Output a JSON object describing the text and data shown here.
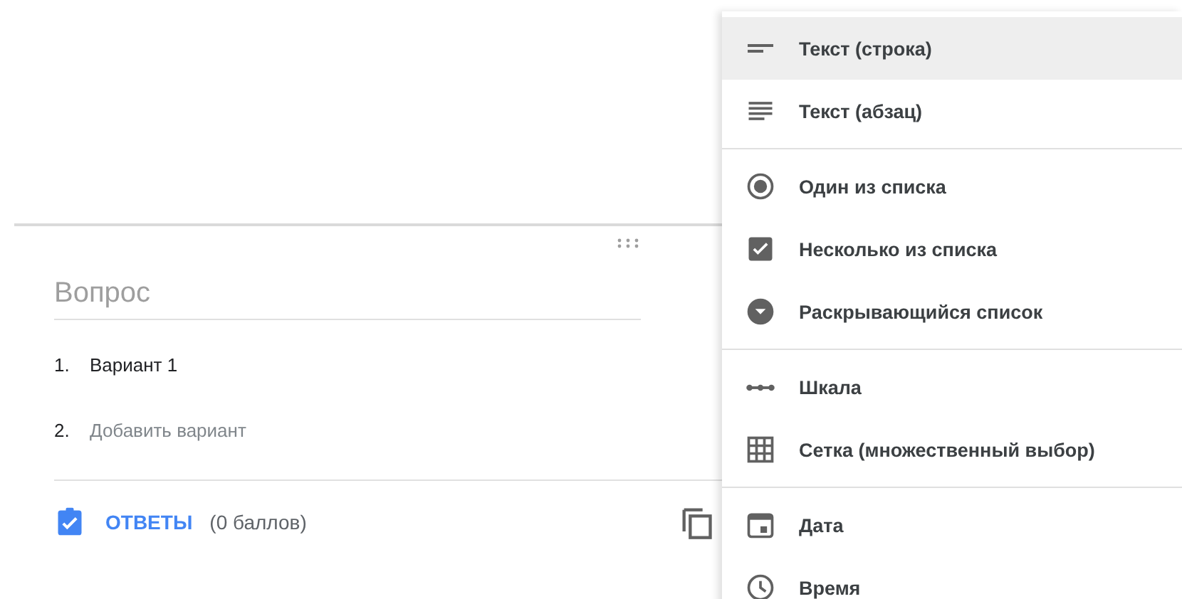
{
  "question_card": {
    "question": {
      "placeholder": "Вопрос"
    },
    "options": [
      {
        "number": "1.",
        "text": "Вариант 1",
        "kind": "option"
      },
      {
        "number": "2.",
        "text": "Добавить вариант",
        "kind": "add"
      }
    ],
    "answer_key": {
      "label": "ОТВЕТЫ",
      "points": "(0 баллов)"
    }
  },
  "type_menu": {
    "groups": [
      {
        "items": [
          {
            "label": "Текст (строка)",
            "kind": "short",
            "selected": true
          },
          {
            "label": "Текст (абзац)",
            "kind": "paragraph",
            "selected": false
          }
        ]
      },
      {
        "items": [
          {
            "label": "Один из списка",
            "kind": "radio",
            "selected": false
          },
          {
            "label": "Несколько из списка",
            "kind": "checkbox",
            "selected": false
          },
          {
            "label": "Раскрывающийся список",
            "kind": "dropdown",
            "selected": false
          }
        ]
      },
      {
        "items": [
          {
            "label": "Шкала",
            "kind": "scale",
            "selected": false
          },
          {
            "label": "Сетка (множественный выбор)",
            "kind": "grid",
            "selected": false
          }
        ]
      },
      {
        "items": [
          {
            "label": "Дата",
            "kind": "date",
            "selected": false
          },
          {
            "label": "Время",
            "kind": "time",
            "selected": false
          }
        ]
      }
    ]
  }
}
